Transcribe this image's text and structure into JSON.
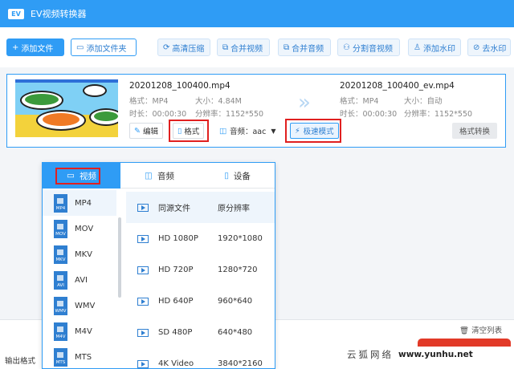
{
  "app": {
    "logo": "EV",
    "title": "EV视频转换器"
  },
  "toolbar": {
    "items": [
      {
        "label": "添加文件",
        "icon": "plus-icon"
      },
      {
        "label": "添加文件夹",
        "icon": "folder-icon"
      },
      {
        "label": "高清压缩",
        "icon": "compress-icon"
      },
      {
        "label": "合并视频",
        "icon": "merge-video-icon"
      },
      {
        "label": "合并音频",
        "icon": "merge-audio-icon"
      },
      {
        "label": "分割音视频",
        "icon": "split-icon"
      },
      {
        "label": "添加水印",
        "icon": "watermark-icon"
      },
      {
        "label": "去水印",
        "icon": "remove-watermark-icon"
      }
    ]
  },
  "file": {
    "src_name": "20201208_100400.mp4",
    "src_format": "格式：MP4",
    "src_size": "大小：4.84M",
    "src_duration": "时长：00:00:30",
    "src_resolution": "分辨率：1152*550",
    "dst_name": "20201208_100400_ev.mp4",
    "dst_format": "格式：MP4",
    "dst_size": "大小：自动",
    "dst_duration": "时长：00:00:30",
    "dst_resolution": "分辨率：1152*550",
    "edit_label": "编辑",
    "format_label": "格式",
    "audio_label": "音频：aac",
    "fast_label": "极速模式",
    "convert_label": "格式转换"
  },
  "dropdown": {
    "tabs": [
      {
        "label": "视频",
        "icon": "video-icon",
        "active": true
      },
      {
        "label": "音频",
        "icon": "audio-icon",
        "active": false
      },
      {
        "label": "设备",
        "icon": "device-icon",
        "active": false
      }
    ],
    "formats": [
      {
        "label": "MP4",
        "badge": "MP4",
        "active": true
      },
      {
        "label": "MOV",
        "badge": "MOV",
        "active": false
      },
      {
        "label": "MKV",
        "badge": "MKV",
        "active": false
      },
      {
        "label": "AVI",
        "badge": "AVI",
        "active": false
      },
      {
        "label": "WMV",
        "badge": "WMV",
        "active": false
      },
      {
        "label": "M4V",
        "badge": "M4V",
        "active": false
      },
      {
        "label": "MTS",
        "badge": "MTS",
        "active": false
      }
    ],
    "resolutions": [
      {
        "name": "同源文件",
        "value": "原分辨率",
        "active": true
      },
      {
        "name": "HD 1080P",
        "value": "1920*1080",
        "active": false
      },
      {
        "name": "HD 720P",
        "value": "1280*720",
        "active": false
      },
      {
        "name": "HD 640P",
        "value": "960*640",
        "active": false
      },
      {
        "name": "SD 480P",
        "value": "640*480",
        "active": false
      },
      {
        "name": "4K Video",
        "value": "3840*2160",
        "active": false
      }
    ]
  },
  "bottom": {
    "clear_label": "清空列表",
    "output_label": "输出格式"
  },
  "watermark": {
    "cn": "云狐网络",
    "url": "www.yunhu.net"
  },
  "colors": {
    "accent": "#2f9cf5",
    "highlight": "#e02020"
  }
}
